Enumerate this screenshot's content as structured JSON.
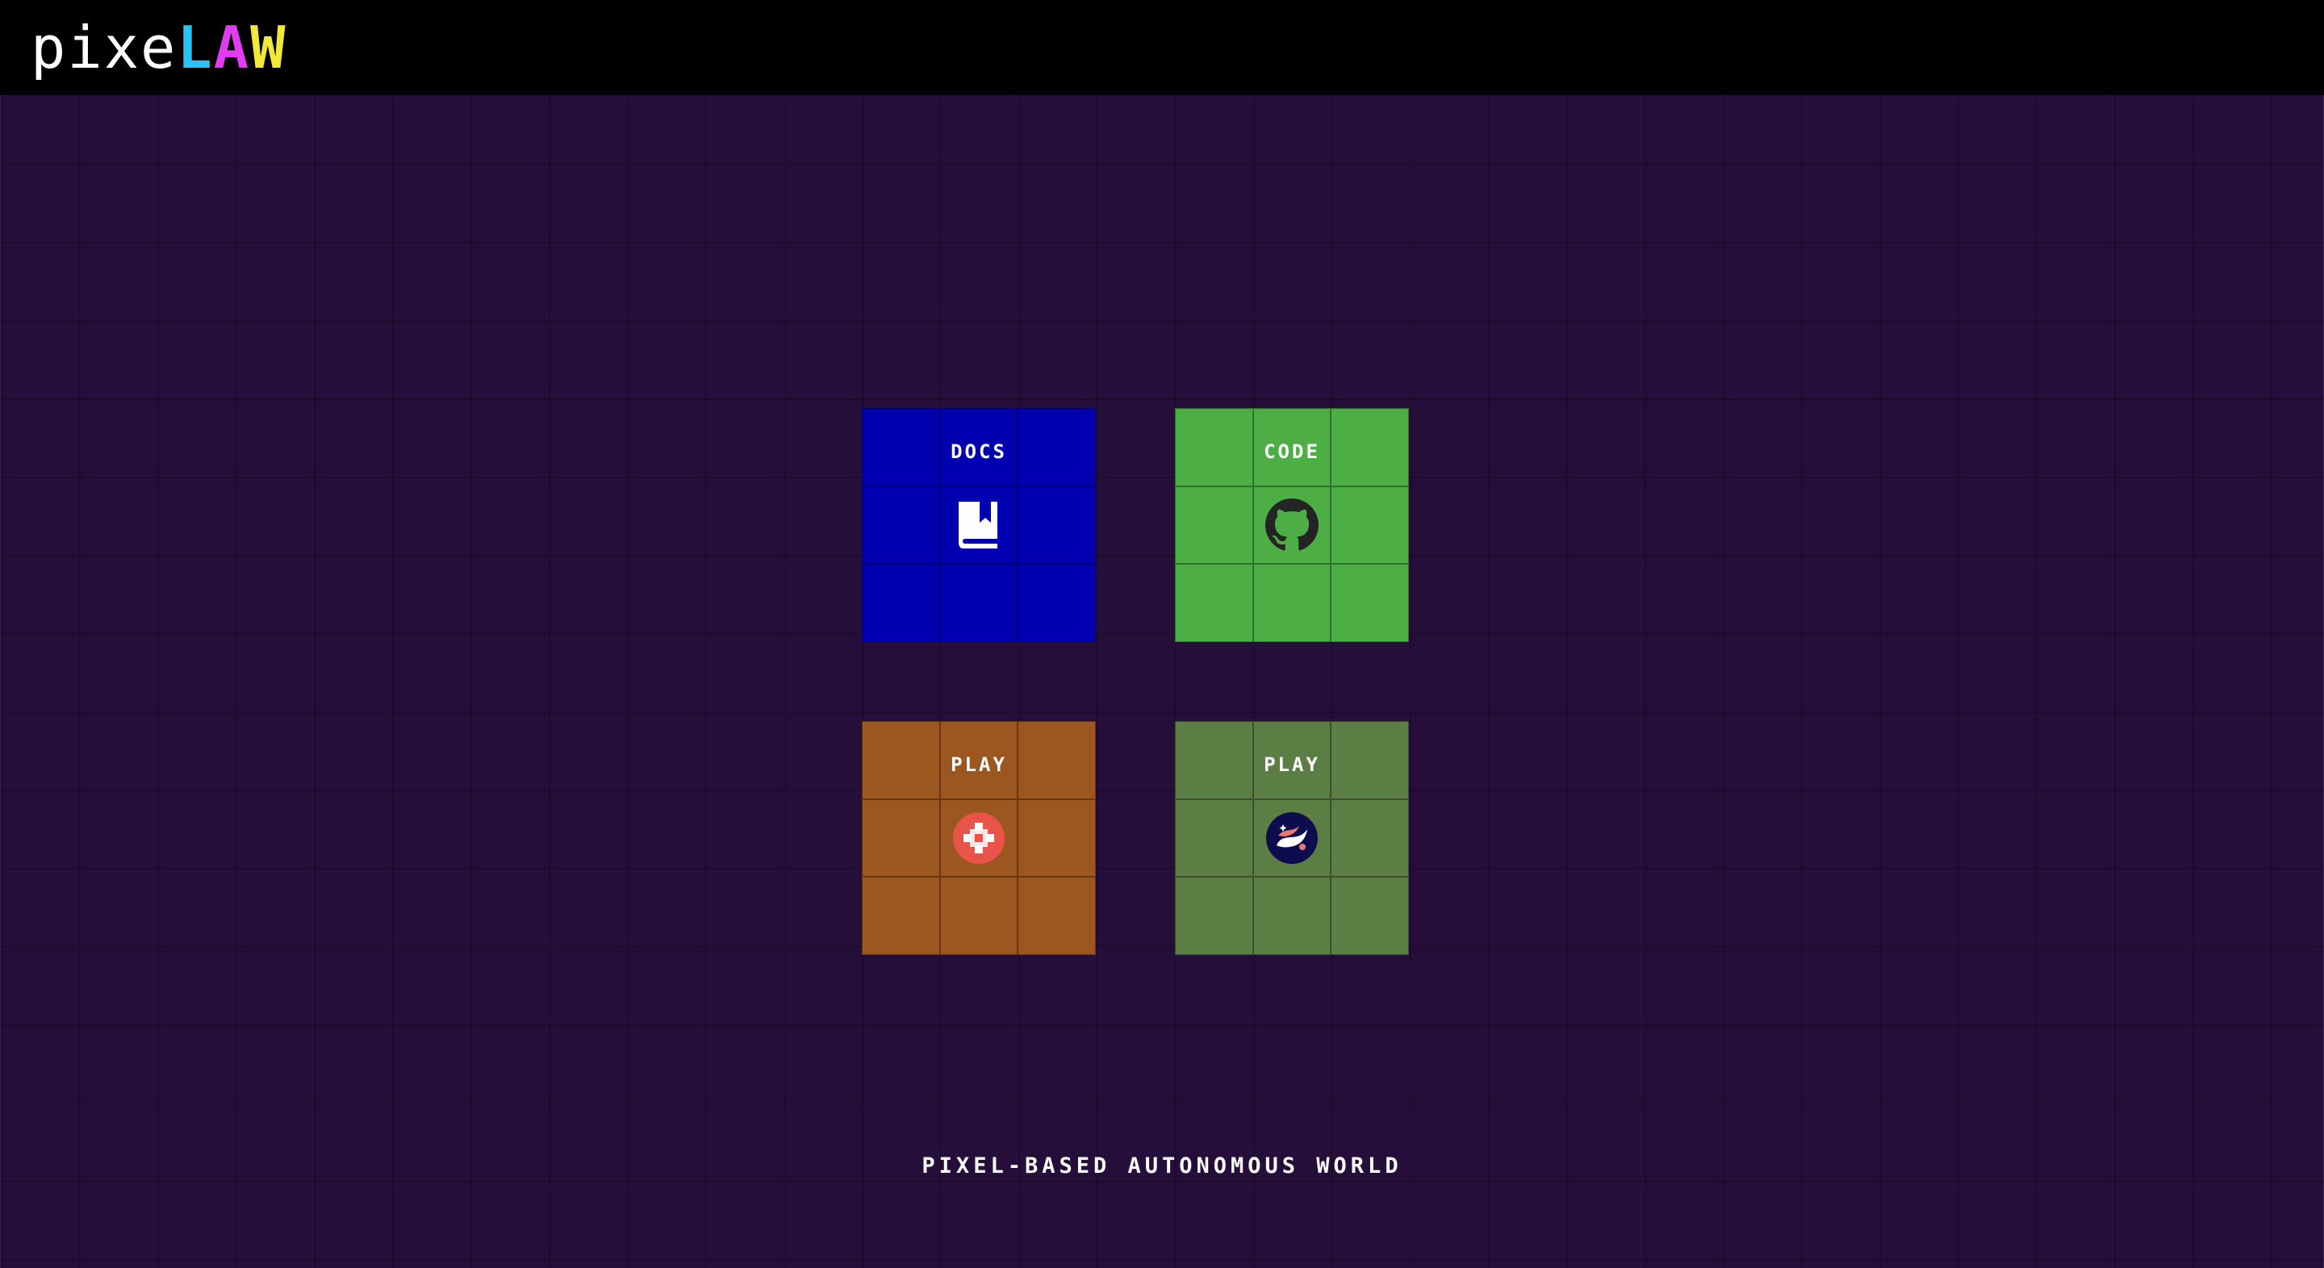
{
  "header": {
    "logo_prefix": "pixe",
    "logo_letters": [
      "L",
      "A",
      "W"
    ],
    "logo_colors": {
      "prefix": "#ffffff",
      "l": "#27c4f5",
      "a": "#e23cf0",
      "w": "#f1e83a"
    }
  },
  "tiles": [
    {
      "label": "DOCS",
      "icon": "book-icon",
      "color": "#0000b0"
    },
    {
      "label": "CODE",
      "icon": "github-icon",
      "color": "#4cae45"
    },
    {
      "label": "PLAY",
      "icon": "pixel-flower-icon",
      "color": "#9c561f"
    },
    {
      "label": "PLAY",
      "icon": "starknet-icon",
      "color": "#5a7e43"
    }
  ],
  "tagline": "PIXEL-BASED AUTONOMOUS WORLD",
  "colors": {
    "background": "#260e3b",
    "header": "#000000"
  }
}
